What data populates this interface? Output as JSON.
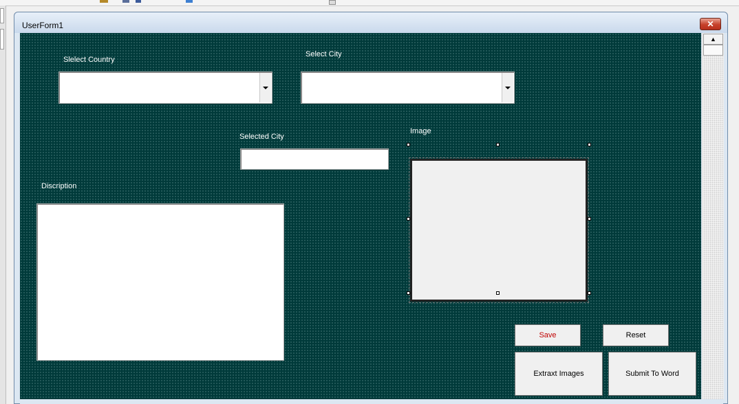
{
  "window": {
    "title": "UserForm1",
    "close_glyph": "✕",
    "scroll_up_glyph": "▲"
  },
  "labels": {
    "select_country": "Slelect  Country",
    "select_city": "Select  City",
    "selected_city": "Selected City",
    "image": "Image",
    "description": "Discription"
  },
  "fields": {
    "country_value": "",
    "city_value": "",
    "selected_city_value": "",
    "description_value": ""
  },
  "buttons": {
    "save": "Save",
    "reset": "Reset",
    "extract_images": "Extraxt Images",
    "submit_to_word": "Submit To Word"
  },
  "colors": {
    "form_background": "#003a3a",
    "label_text": "#ffffff",
    "save_text": "#c00000"
  }
}
